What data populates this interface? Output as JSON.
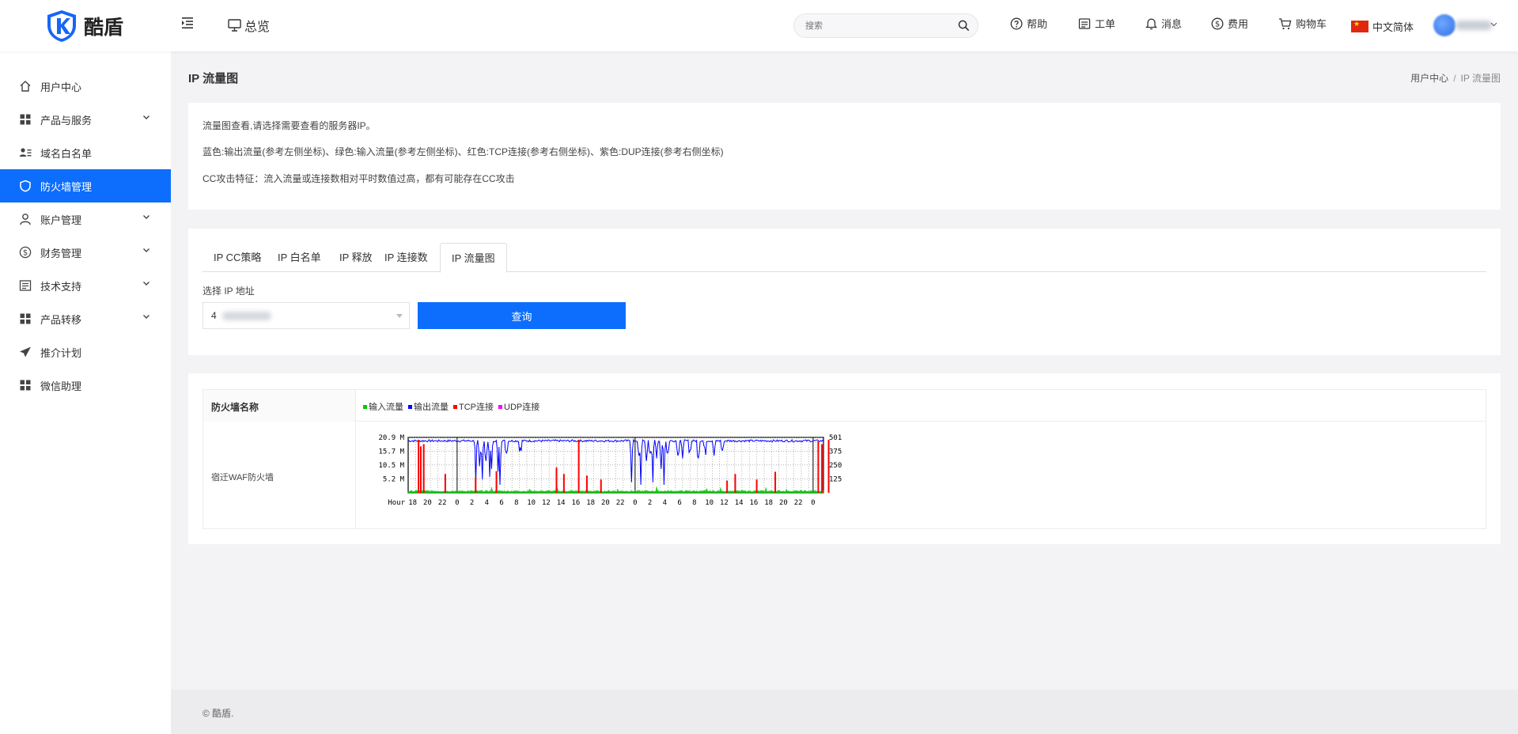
{
  "header": {
    "brand": "酷盾",
    "overview": "总览",
    "search_placeholder": "搜索",
    "menu": [
      {
        "label": "帮助",
        "icon": "help-circle-icon"
      },
      {
        "label": "工单",
        "icon": "ticket-icon"
      },
      {
        "label": "消息",
        "icon": "bell-icon"
      },
      {
        "label": "费用",
        "icon": "dollar-circle-icon"
      },
      {
        "label": "购物车",
        "icon": "cart-icon"
      }
    ],
    "language": "中文简体"
  },
  "sidebar": {
    "items": [
      {
        "label": "用户中心",
        "icon": "home-icon",
        "expandable": false,
        "active": false
      },
      {
        "label": "产品与服务",
        "icon": "grid-icon",
        "expandable": true,
        "active": false
      },
      {
        "label": "域名白名单",
        "icon": "user-list-icon",
        "expandable": false,
        "active": false
      },
      {
        "label": "防火墙管理",
        "icon": "shield-icon",
        "expandable": false,
        "active": true
      },
      {
        "label": "账户管理",
        "icon": "user-icon",
        "expandable": true,
        "active": false
      },
      {
        "label": "财务管理",
        "icon": "dollar-circle-icon",
        "expandable": true,
        "active": false
      },
      {
        "label": "技术支持",
        "icon": "document-icon",
        "expandable": true,
        "active": false
      },
      {
        "label": "产品转移",
        "icon": "grid-icon",
        "expandable": true,
        "active": false
      },
      {
        "label": "推介计划",
        "icon": "send-icon",
        "expandable": false,
        "active": false
      },
      {
        "label": "微信助理",
        "icon": "grid-icon",
        "expandable": false,
        "active": false
      }
    ]
  },
  "page": {
    "title": "IP 流量图",
    "breadcrumb": [
      "用户中心",
      "IP 流量图"
    ]
  },
  "info": {
    "line1": "流量图查看,请选择需要查看的服务器IP。",
    "line2": "蓝色:输出流量(参考左侧坐标)、绿色:输入流量(参考左侧坐标)、红色:TCP连接(参考右侧坐标)、紫色:DUP连接(参考右侧坐标)",
    "line3": "CC攻击特征：流入流量或连接数相对平时数值过高，都有可能存在CC攻击"
  },
  "tabs": {
    "items": [
      "IP CC策略",
      "IP 白名单",
      "IP 释放",
      "IP 连接数",
      "IP 流量图"
    ],
    "active_index": 4
  },
  "query": {
    "label": "选择 IP 地址",
    "selected_ip_prefix": "4",
    "button": "查询"
  },
  "firewall_table": {
    "header": "防火墙名称",
    "legend": [
      {
        "label": "输入流量",
        "color": "#00cc00"
      },
      {
        "label": "输出流量",
        "color": "#0000ff"
      },
      {
        "label": "TCP连接",
        "color": "#ff0000"
      },
      {
        "label": "UDP连接",
        "color": "#ff00ff"
      }
    ],
    "row_name": "宿迁WAF防火墙"
  },
  "chart_data": {
    "type": "line",
    "left_axis_ticks": [
      "20.9 M",
      "15.7 M",
      "10.5 M",
      "5.2 M"
    ],
    "left_ylim": [
      0,
      20.9
    ],
    "right_axis_ticks": [
      "501",
      "375",
      "250",
      "125"
    ],
    "right_ylim": [
      0,
      501
    ],
    "xlabel": "Hour",
    "x_ticks": [
      "18",
      "20",
      "22",
      "0",
      "2",
      "4",
      "6",
      "8",
      "10",
      "12",
      "14",
      "16",
      "18",
      "20",
      "22",
      "0",
      "2",
      "4",
      "6",
      "8",
      "10",
      "12",
      "14",
      "16",
      "18",
      "20",
      "22",
      "0"
    ],
    "grid": true,
    "series": [
      {
        "name": "输出流量",
        "color": "#0000ff",
        "axis": "left",
        "baseline_level": 19.6,
        "dips": [
          [
            9.1,
            4
          ],
          [
            9.6,
            10
          ],
          [
            10.0,
            5
          ],
          [
            10.5,
            12
          ],
          [
            11.0,
            6
          ],
          [
            11.3,
            9
          ],
          [
            12.1,
            8
          ],
          [
            12.4,
            3
          ],
          [
            13.2,
            15
          ],
          [
            15.1,
            17
          ],
          [
            30.1,
            4
          ],
          [
            31.1,
            14
          ],
          [
            31.4,
            3
          ],
          [
            32.1,
            12
          ],
          [
            32.6,
            15
          ],
          [
            33.0,
            4
          ],
          [
            33.5,
            13
          ],
          [
            34.1,
            9
          ],
          [
            34.5,
            3
          ],
          [
            35.0,
            15
          ],
          [
            36.4,
            14
          ],
          [
            37.0,
            13
          ],
          [
            38.0,
            16
          ],
          [
            39.1,
            13
          ],
          [
            40.0,
            17
          ],
          [
            41.2,
            14
          ],
          [
            42.4,
            16
          ]
        ]
      },
      {
        "name": "输入流量",
        "color": "#00cc00",
        "axis": "left",
        "baseline_level": 0.4,
        "spikes": [
          [
            11.2,
            2.1
          ],
          [
            16.4,
            1.5
          ],
          [
            20.1,
            1.9
          ],
          [
            28.3,
            1.4
          ],
          [
            33.5,
            2.4
          ],
          [
            40.2,
            1.6
          ],
          [
            42.1,
            2.0
          ],
          [
            45.0,
            1.2
          ],
          [
            48.2,
            2.0
          ],
          [
            51.0,
            1.4
          ],
          [
            53.0,
            1.1
          ]
        ]
      },
      {
        "name": "TCP连接",
        "color": "#ff0000",
        "axis": "right",
        "spikes": [
          [
            1.4,
            480
          ],
          [
            1.7,
            420
          ],
          [
            2.1,
            440
          ],
          [
            5.0,
            170
          ],
          [
            9.1,
            140
          ],
          [
            11.9,
            195
          ],
          [
            20.0,
            230
          ],
          [
            21.0,
            170
          ],
          [
            23.0,
            480
          ],
          [
            24.1,
            155
          ],
          [
            26.0,
            120
          ],
          [
            43.0,
            110
          ],
          [
            44.1,
            170
          ],
          [
            47.0,
            120
          ],
          [
            49.5,
            190
          ],
          [
            55.3,
            470
          ],
          [
            55.8,
            440
          ],
          [
            56.7,
            480
          ]
        ]
      },
      {
        "name": "UDP连接",
        "color": "#ff00ff",
        "axis": "right",
        "spikes": []
      }
    ]
  },
  "footer": "© 酷盾."
}
